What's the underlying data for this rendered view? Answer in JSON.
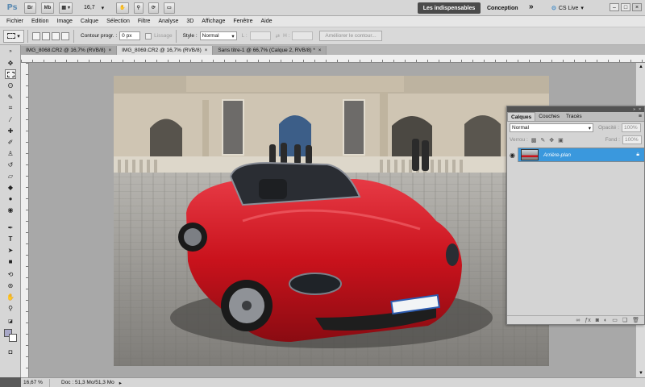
{
  "appbar": {
    "logo": "Ps",
    "btn_br": "Br",
    "btn_mb": "Mb",
    "zoom": "16,7",
    "essentials": "Les indispensables",
    "design": "Conception",
    "more": "»",
    "cslive": "CS Live",
    "win_min": "–",
    "win_max": "□",
    "win_close": "×"
  },
  "menu": [
    "Fichier",
    "Edition",
    "Image",
    "Calque",
    "Sélection",
    "Filtre",
    "Analyse",
    "3D",
    "Affichage",
    "Fenêtre",
    "Aide"
  ],
  "options": {
    "feather_label": "Contour progr. :",
    "feather_value": "0 px",
    "antialias_label": "Lissage",
    "style_label": "Style :",
    "style_value": "Normal",
    "width_label": "L :",
    "height_label": "H :",
    "refine_button": "Améliorer le contour..."
  },
  "tabs": [
    {
      "label": "IMG_8068.CR2 @ 16,7% (RVB/8)",
      "active": false
    },
    {
      "label": "IMG_8069.CR2 @ 16,7% (RVB/8)",
      "active": true
    },
    {
      "label": "Sans titre-1 @ 66,7% (Calque 2, RVB/8) *",
      "active": false
    }
  ],
  "status": {
    "zoom": "16,67 %",
    "doc": "Doc : 51,3 Mo/51,3 Mo",
    "arrow": "▸"
  },
  "layers_panel": {
    "tabs": [
      "Calques",
      "Couches",
      "Tracés"
    ],
    "blend_mode": "Normal",
    "opacity_label": "Opacité :",
    "opacity_value": "100%",
    "lock_label": "Verrou :",
    "fill_label": "Fond :",
    "fill_value": "100%",
    "layer_name": "Arrière-plan"
  },
  "colors": {
    "selected_layer": "#3a98dd",
    "car_red": "#c9121c"
  }
}
